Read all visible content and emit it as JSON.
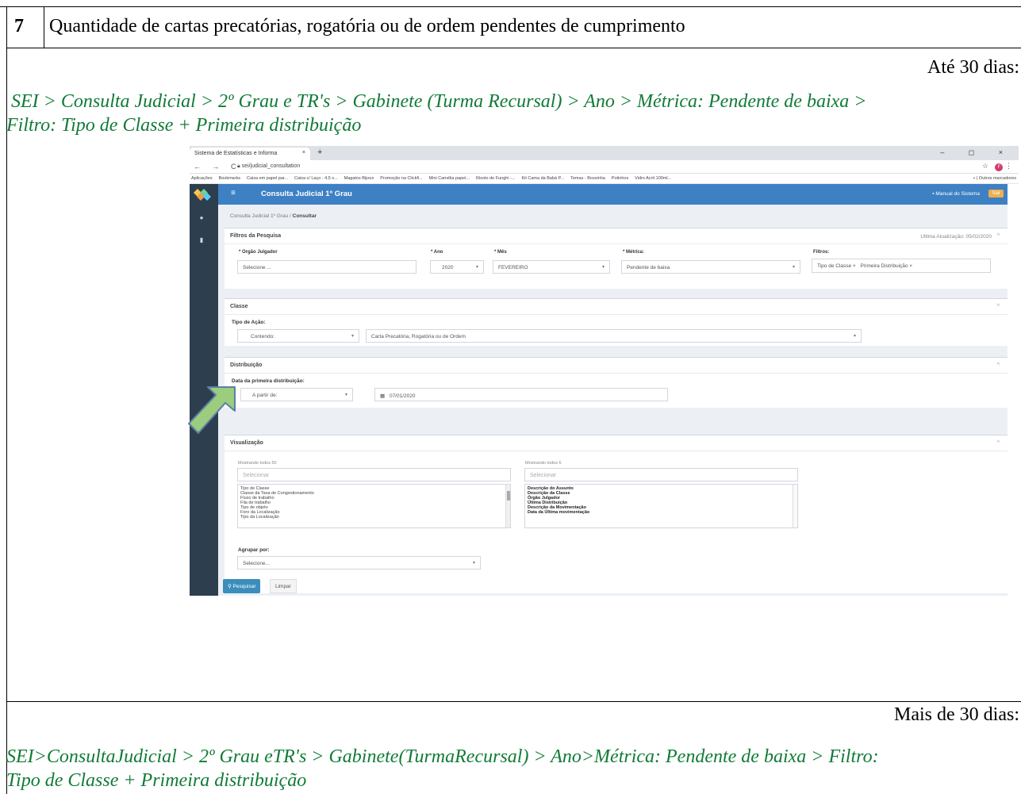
{
  "item": {
    "number": "7",
    "title": "Quantidade de cartas precatórias, rogatória ou de ordem pendentes de cumprimento"
  },
  "section_1": {
    "label": "Até 30 dias:",
    "path_line1": "SEI > Consulta Judicial > 2º Grau e TR's > Gabinete (Turma Recursal) > Ano > Métrica: Pendente de baixa >",
    "path_line2": "Filtro: Tipo de Classe + Primeira distribuição"
  },
  "section_2": {
    "label": "Mais de 30 dias:",
    "path_line1": "SEI>ConsultaJudicial > 2º Grau eTR's > Gabinete(TurmaRecursal) > Ano>Métrica: Pendente de baixa > Filtro:",
    "path_line2": "Tipo de Classe + Primeira distribuição"
  },
  "screenshot": {
    "browser": {
      "tab_title": "Sistema de Estatísticas e Informa",
      "url": "sei/judicial_consultation",
      "bookmarks": [
        "Aplicações",
        "Bookmarks",
        "Caixa em papel par...",
        "Caixa c/ Laço - 4,5 x...",
        "Magatos Bijoux",
        "Promoção na Clickfi...",
        "Mini Camélia papel...",
        "Risoto de Funghi -...",
        "Kit Cama da Babá P...",
        "Temas - Bossinha",
        "Potinhos",
        "Vidro Acrit 100ml..."
      ],
      "bookmarks_more": "»",
      "other_bookmarks": "Outros marcadores",
      "profile_initial": "F"
    },
    "app": {
      "title": "Consulta Judicial 1º Grau",
      "manual": "Manual do Sistema",
      "logout": "Sair",
      "breadcrumb_parent": "Consulta Judicial 1º Grau",
      "breadcrumb_sep": "/",
      "breadcrumb_current": "Consultar"
    },
    "filters_panel": {
      "title": "Filtros da Pesquisa",
      "last_update": "Ultima Atualização: 05/02/2020",
      "orgao_label": "* Orgão Julgador",
      "orgao_value": "Selecione ...",
      "ano_label": "* Ano",
      "ano_value": "2020",
      "mes_label": "* Mês",
      "mes_value": "FEVEREIRO",
      "metrica_label": "* Métrica:",
      "metrica_value": "Pendente de baixa",
      "filtros_label": "Filtros:",
      "filtros_chips": [
        "Tipo de Classe ×",
        "Primeira Distribuição ×"
      ]
    },
    "classe_panel": {
      "title": "Classe",
      "tipo_acao_label": "Tipo de Ação:",
      "operator_value": "Contendo:",
      "tipo_acao_value": "Carta Precatória, Rogatória ou de Ordem"
    },
    "distribuicao_panel": {
      "title": "Distribuição",
      "date_label": "Data da primeira distribuição:",
      "operator_value": "A partir de:",
      "date_value": "07/01/2020"
    },
    "visualizacao_panel": {
      "title": "Visualização",
      "left_caption": "Mostrando todos 50",
      "left_placeholder": "Selecionar",
      "left_items": [
        "Tipo de Classe",
        "Classe da Taxa de Congestionamento",
        "Fluxo de trabalho",
        "Fila de trabalho",
        "Tipo de objeto",
        "Foro da Localização",
        "Tipo da Localização"
      ],
      "right_caption": "Mostrando todos 6",
      "right_placeholder": "Selecionar",
      "right_items": [
        "Descrição do Assunto",
        "Descrição da Classe",
        "Órgão Julgador",
        "Última Distribuição",
        "Descrição da Movimentação",
        "Data da Última movimentação"
      ],
      "agrupar_label": "Agrupar por:",
      "agrupar_value": "Selecione..."
    },
    "buttons": {
      "search": "Pesquisar",
      "clear": "Limpar"
    },
    "colors": {
      "header_blue": "#3d80c4",
      "sidebar_dark": "#2d3e4f",
      "path_green": "#107b36",
      "annotation_arrow": "#9ccc7d"
    },
    "icons": [
      "star-icon",
      "lock-icon",
      "calendar-icon",
      "search-icon",
      "book-icon",
      "dashboard-icon",
      "file-icon"
    ]
  }
}
